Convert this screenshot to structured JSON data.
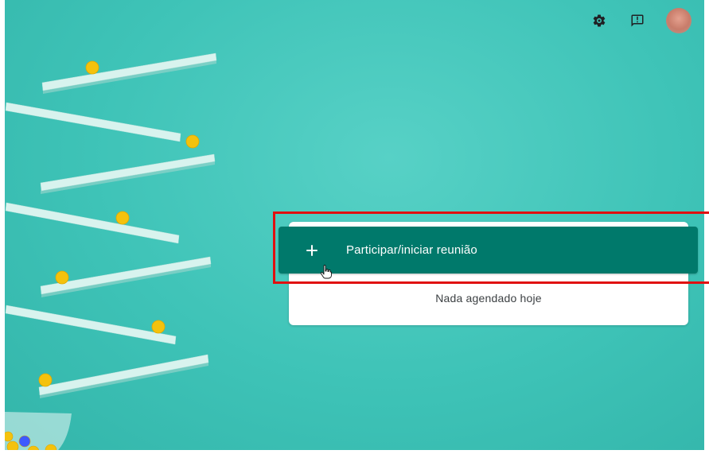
{
  "header": {
    "icons": [
      "settings-icon",
      "feedback-icon"
    ],
    "avatar": "account-avatar"
  },
  "main": {
    "join_button": {
      "icon": "plus-icon",
      "label": "Participar/iniciar reunião"
    },
    "schedule_empty_text": "Nada agendado hoje"
  },
  "colors": {
    "background": "#3ec3b7",
    "button": "#00796b",
    "card": "#ffffff",
    "highlight_box": "#e01010"
  }
}
